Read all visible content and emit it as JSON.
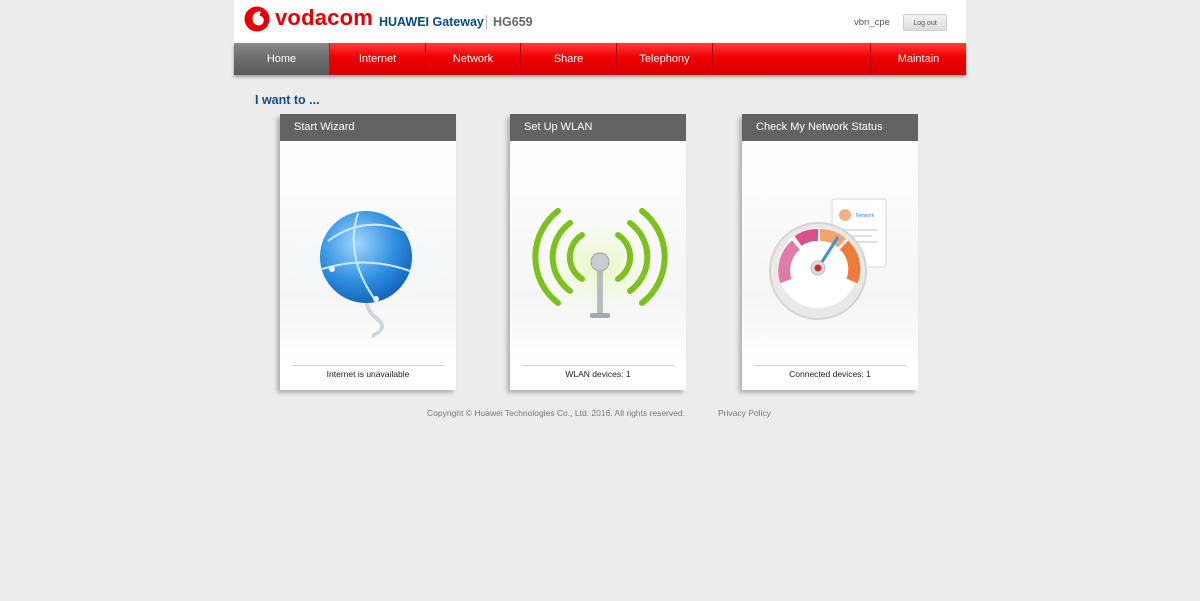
{
  "header": {
    "brand": "vodacom",
    "gateway_label": "HUAWEI Gateway",
    "model": "HG659",
    "username": "vbn_cpe",
    "logout_label": "Log out",
    "brand_color": "#e60000"
  },
  "nav": {
    "items": [
      {
        "label": "Home",
        "active": true
      },
      {
        "label": "Internet"
      },
      {
        "label": "Network"
      },
      {
        "label": "Share"
      },
      {
        "label": "Telephony"
      },
      {
        "label": ""
      },
      {
        "label": "Maintain"
      }
    ]
  },
  "main": {
    "heading": "I want to ...",
    "cards": [
      {
        "title": "Start Wizard",
        "status": "Internet is unavailable",
        "icon": "globe-icon"
      },
      {
        "title": "Set Up WLAN",
        "status": "WLAN devices: 1",
        "icon": "wlan-antenna-icon"
      },
      {
        "title": "Check My Network Status",
        "status": "Connected devices: 1",
        "icon": "network-gauge-icon",
        "mini_report_title": "Network"
      }
    ]
  },
  "footer": {
    "copyright": "Copyright © Huawei Technologies Co., Ltd. 2016. All rights reserved.",
    "privacy": "Privacy Policy"
  }
}
